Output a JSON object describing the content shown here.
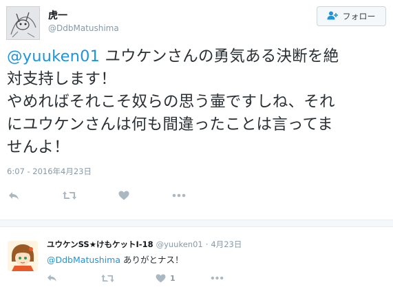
{
  "main_tweet": {
    "display_name": "虎一",
    "handle": "@DdbMatushima",
    "follow_label": "フォロー",
    "mention": "@yuuken01",
    "text": " ユウケンさんの勇気ある決断を絶\n対支持します！\nやめればそれこそ奴らの思う壷ですしね、それ\nにユウケンさんは何も間違ったことは言ってま\nせんよ！",
    "timestamp": "6:07 - 2016年4月23日",
    "icons": [
      "reply-icon",
      "retweet-icon",
      "like-icon",
      "more-icon"
    ]
  },
  "reply_tweet": {
    "display_name": "ユウケンSS★けもケットI-18",
    "handle": "@yuuken01",
    "separator": "·",
    "date": "4月23日",
    "mention": "@DdbMatushima",
    "text": " ありがとナス！",
    "like_count": "1",
    "icons": [
      "reply-icon",
      "retweet-icon",
      "like-icon",
      "more-icon"
    ]
  },
  "colors": {
    "link": "#1b95e0",
    "secondary_text": "#8899a6",
    "action_icon": "#aab8c2"
  }
}
